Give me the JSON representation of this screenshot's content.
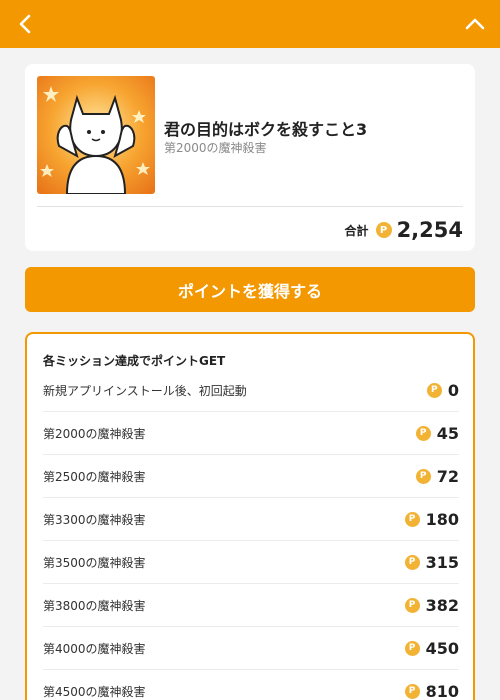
{
  "header": {
    "back_icon": "chevron-left-icon",
    "collapse_icon": "chevron-up-icon",
    "bg_color": "#f39800"
  },
  "app": {
    "title": "君の目的はボクを殺すこと3",
    "subtitle": "第2000の魔神殺害",
    "total_label": "合計",
    "total_points": "2,254",
    "coin_symbol": "P"
  },
  "cta_label": "ポイントを獲得する",
  "missions": {
    "heading": "各ミッション達成でポイントGET",
    "items": [
      {
        "label": "新規アプリインストール後、初回起動",
        "points": "0"
      },
      {
        "label": "第2000の魔神殺害",
        "points": "45"
      },
      {
        "label": "第2500の魔神殺害",
        "points": "72"
      },
      {
        "label": "第3300の魔神殺害",
        "points": "180"
      },
      {
        "label": "第3500の魔神殺害",
        "points": "315"
      },
      {
        "label": "第3800の魔神殺害",
        "points": "382"
      },
      {
        "label": "第4000の魔神殺害",
        "points": "450"
      },
      {
        "label": "第4500の魔神殺害",
        "points": "810"
      }
    ]
  },
  "colors": {
    "accent": "#f39800",
    "coin": "#f2b335",
    "background": "#f3f3f3"
  }
}
